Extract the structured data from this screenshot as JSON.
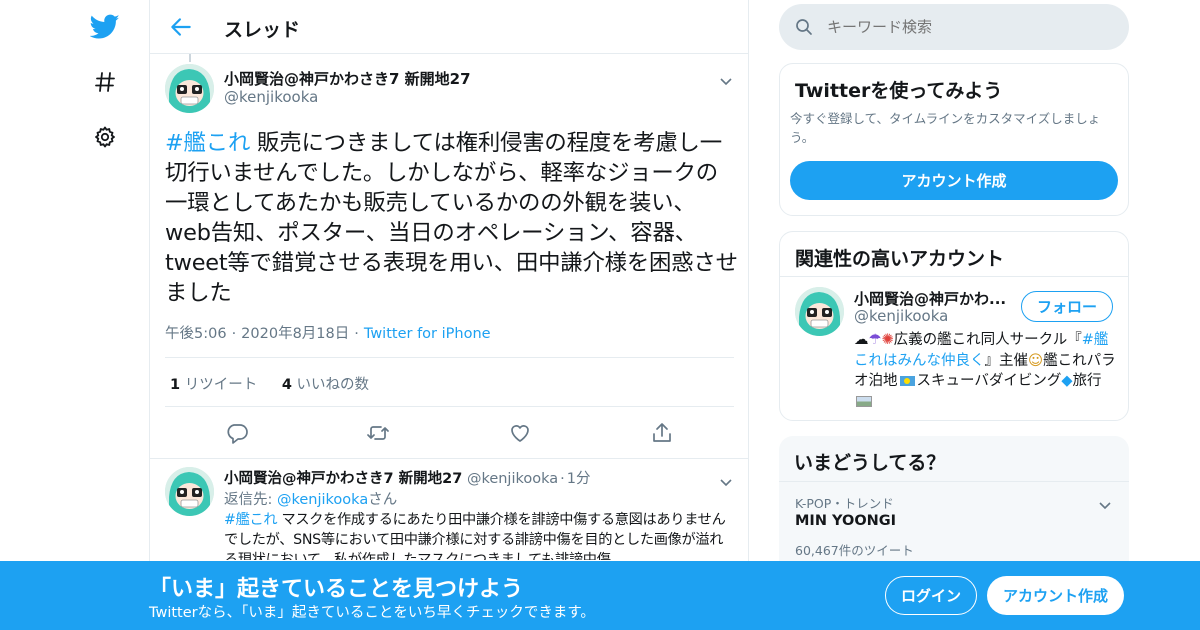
{
  "colors": {
    "accent": "#1da1f2",
    "text": "#14171a",
    "secondary": "#657786",
    "border": "#e6ecf0"
  },
  "nav": {
    "icons": [
      "twitter-bird-icon",
      "hashtag-icon",
      "gear-icon"
    ]
  },
  "header": {
    "title": "スレッド"
  },
  "main_tweet": {
    "author_name": "小岡賢治@神戸かわさき7 新開地27",
    "author_handle": "@kenjikooka",
    "hashtag": "#艦これ",
    "body": " 販売につきましては権利侵害の程度を考慮し一切行いませんでした。しかしながら、軽率なジョークの一環としてあたかも販売しているかのの外観を装い、web告知、ポスター、当日のオペレーション、容器、tweet等で錯覚させる表現を用い、田中謙介様を困惑させました",
    "time": "午後5:06",
    "date": "2020年8月18日",
    "source": "Twitter for iPhone",
    "retweet_count": "1",
    "retweet_label": " リツイート",
    "like_count": "4",
    "like_label": " いいねの数"
  },
  "reply_tweet": {
    "author_name": "小岡賢治@神戸かわさき7 新開地27",
    "author_handle": "@kenjikooka",
    "dot": "·",
    "time": "1分",
    "replying_prefix": "返信先: ",
    "replying_to": "@kenjikooka",
    "replying_suffix": "さん",
    "hashtag": "#艦これ",
    "body": " マスクを作成するにあたり田中謙介様を誹謗中傷する意図はありませんでしたが、SNS等において田中謙介様に対する誹謗中傷を目的とした画像が溢れる現状において、私が作成したマスクにつきましても誹謗中傷"
  },
  "search": {
    "placeholder": "キーワード検索"
  },
  "signup_card": {
    "title": "Twitterを使ってみよう",
    "description": "今すぐ登録して、タイムラインをカスタマイズしましょう。",
    "button": "アカウント作成"
  },
  "related_card": {
    "title": "関連性の高いアカウント",
    "name": "小岡賢治@神戸かわ...",
    "handle": "@kenjikooka",
    "follow": "フォロー",
    "bio_pre": "広義の艦これ同人サークル『",
    "bio_tag": "#艦これはみんな仲良く",
    "bio_mid": "』主催",
    "bio_mid2": "艦これパラオ泊地",
    "bio_mid3": "スキューバダイビング",
    "bio_end": "旅行"
  },
  "trends": {
    "title": "いまどうしてる？",
    "category": "K-POP・トレンド",
    "name": "MIN YOONGI",
    "count": "60,467件のツイート"
  },
  "banner": {
    "headline": "「いま」起きていることを見つけよう",
    "subtext": "Twitterなら、「いま」起きていることをいち早くチェックできます。",
    "login": "ログイン",
    "signup": "アカウント作成"
  }
}
